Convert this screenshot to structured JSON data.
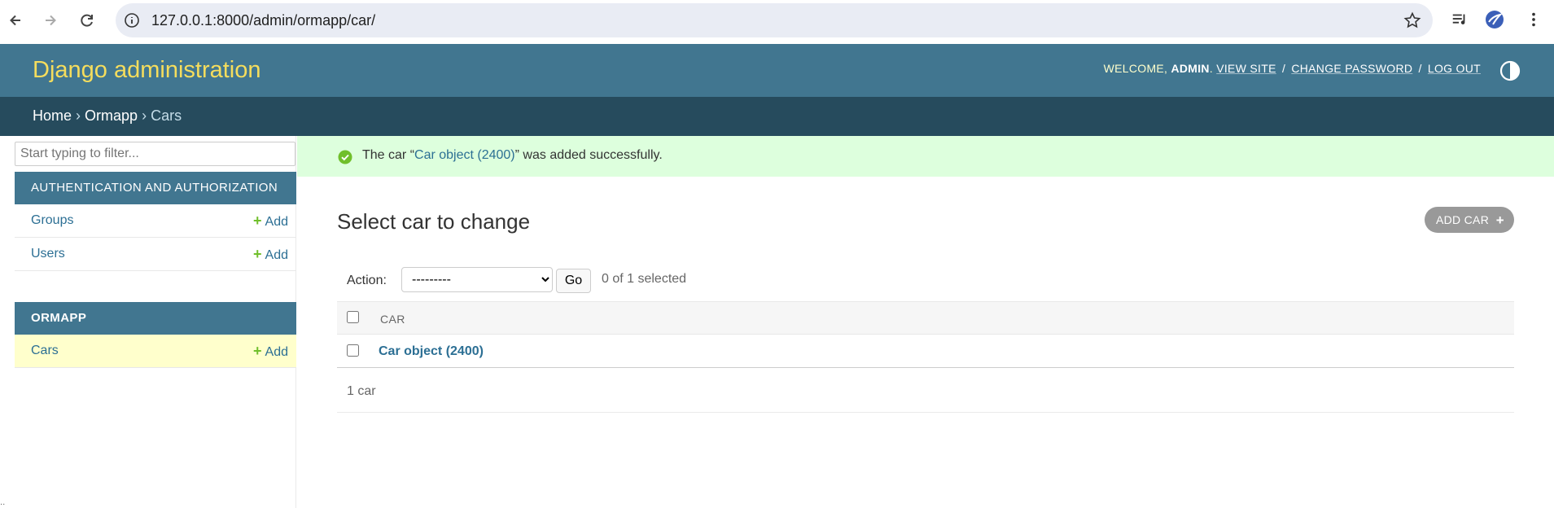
{
  "browser": {
    "url": "127.0.0.1:8000/admin/ormapp/car/"
  },
  "header": {
    "branding": "Django administration",
    "welcome": "WELCOME,",
    "username": "ADMIN",
    "view_site": "VIEW SITE",
    "change_password": "CHANGE PASSWORD",
    "log_out": "LOG OUT",
    "separator": "/"
  },
  "breadcrumbs": {
    "home": "Home",
    "app": "Ormapp",
    "current": "Cars",
    "sep": "›"
  },
  "sidebar": {
    "filter_placeholder": "Start typing to filter...",
    "auth_caption": "AUTHENTICATION AND AUTHORIZATION",
    "ormapp_caption": "ORMAPP",
    "add_label": "Add",
    "models": {
      "groups": "Groups",
      "users": "Users",
      "cars": "Cars"
    }
  },
  "message": {
    "prefix": "The car “",
    "object_link": "Car object (2400)",
    "suffix": "” was added successfully."
  },
  "main": {
    "title": "Select car to change",
    "add_button": "ADD CAR",
    "action_label": "Action:",
    "action_selected": "---------",
    "go_button": "Go",
    "selection_counter": "0 of 1 selected",
    "column_header": "CAR",
    "rows": [
      "Car object (2400)"
    ],
    "result_count": "1 car"
  },
  "colors": {
    "header_bg": "#417690",
    "breadcrumb_bg": "#264b5d",
    "branding": "#f5dd5d",
    "success_bg": "#ddffdd",
    "link": "#2c6f94",
    "current_model_bg": "#ffffcc"
  }
}
